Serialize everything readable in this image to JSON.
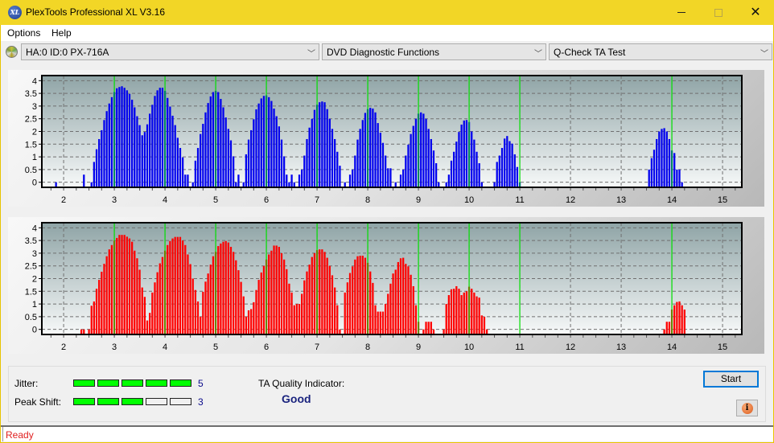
{
  "window": {
    "title": "PlexTools Professional XL V3.16",
    "app_icon": "xl-logo-icon",
    "controls": {
      "minimize": "minimize-icon",
      "maximize": "maximize-icon",
      "close": "close-icon"
    }
  },
  "menu": {
    "items": [
      {
        "label": "Options"
      },
      {
        "label": "Help"
      }
    ]
  },
  "toolbar": {
    "drive_icon": "disc-icon",
    "drive_select": {
      "value": "HA:0 ID:0  PX-716A"
    },
    "function_select": {
      "value": "DVD Diagnostic Functions"
    },
    "test_select": {
      "value": "Q-Check TA Test"
    },
    "dropdown_icon": "chevron-down-icon"
  },
  "colors": {
    "top_bars": "#0000ee",
    "bottom_bars": "#ff0000",
    "marker_lines": "#00e000",
    "meter_on": "#00ff00",
    "quality_text": "#1a237e",
    "status_text": "#e02020"
  },
  "chart_data": [
    {
      "type": "bar",
      "title": "",
      "series_name": "TA histogram (lands)",
      "color": "#0000ee",
      "xlabel": "",
      "ylabel": "",
      "xlim": [
        1.57,
        15.38
      ],
      "ylim": [
        -0.2,
        4.2
      ],
      "x_ticks": [
        "2",
        "3",
        "4",
        "5",
        "6",
        "7",
        "8",
        "9",
        "10",
        "11",
        "12",
        "13",
        "14",
        "15"
      ],
      "y_ticks": [
        "0",
        "0.5",
        "1",
        "1.5",
        "2",
        "2.5",
        "3",
        "3.5",
        "4"
      ],
      "grid": true,
      "marker_lines_x": [
        3,
        4,
        5,
        6,
        7,
        8,
        9,
        10,
        11,
        14
      ],
      "x_start": 1.85,
      "x_step": 0.05,
      "values": [
        0.0,
        -1,
        -1,
        -1,
        -1,
        -1,
        -1,
        -1,
        -1,
        -1,
        -1,
        0.3,
        -1,
        -1,
        0.0,
        0.8,
        1.3,
        1.7,
        2.05,
        2.45,
        2.8,
        3.1,
        3.35,
        3.55,
        3.7,
        3.75,
        3.78,
        3.72,
        3.62,
        3.48,
        3.25,
        2.95,
        2.6,
        2.25,
        1.85,
        1.98,
        2.28,
        2.7,
        3.05,
        3.4,
        3.62,
        3.72,
        3.72,
        3.6,
        3.32,
        2.98,
        2.62,
        2.25,
        1.75,
        1.35,
        0.98,
        0.3,
        0.3,
        -1,
        0.0,
        0.85,
        1.35,
        1.9,
        2.3,
        2.75,
        3.12,
        3.38,
        3.55,
        3.6,
        3.55,
        3.28,
        2.95,
        2.55,
        2.1,
        1.65,
        1.02,
        0.0,
        0.3,
        -1,
        0.0,
        1.1,
        1.68,
        2.05,
        2.48,
        2.87,
        3.1,
        3.3,
        3.4,
        3.42,
        3.35,
        3.2,
        2.9,
        2.6,
        2.2,
        1.68,
        1.02,
        0.3,
        0.0,
        0.3,
        0.0,
        -1,
        0.3,
        0.5,
        1.05,
        1.7,
        2.15,
        2.5,
        2.85,
        3.05,
        3.15,
        3.18,
        3.15,
        2.88,
        2.5,
        2.1,
        1.7,
        1.2,
        0.65,
        -1,
        0.0,
        -1,
        0.3,
        0.5,
        1.05,
        1.68,
        2.1,
        2.45,
        2.73,
        2.88,
        2.93,
        2.9,
        2.75,
        2.33,
        1.95,
        1.55,
        1.05,
        0.55,
        0.55,
        -1,
        0.0,
        -1,
        0.3,
        0.5,
        1.05,
        1.48,
        1.9,
        2.22,
        2.5,
        2.7,
        2.75,
        2.7,
        2.5,
        2.1,
        1.7,
        1.25,
        0.75,
        0.0,
        -1,
        -1,
        0.0,
        0.3,
        0.85,
        1.2,
        1.6,
        1.98,
        2.27,
        2.43,
        2.45,
        2.37,
        2.0,
        1.68,
        1.2,
        0.75,
        0.0,
        -1,
        -1,
        -1,
        -1,
        0.0,
        0.8,
        1.05,
        1.35,
        1.72,
        1.82,
        1.62,
        1.52,
        1.1,
        0.6,
        0.0
      ],
      "values_note": "-1 means no bar at that bin; tail near 14",
      "tail_x_start": 13.55,
      "tail_values": [
        0.5,
        0.95,
        1.28,
        1.7,
        2.0,
        2.1,
        2.13,
        2.0,
        1.7,
        1.25,
        1.15,
        0.5,
        0.5,
        0.0
      ]
    },
    {
      "type": "bar",
      "title": "",
      "series_name": "TA histogram (pits)",
      "color": "#ff0000",
      "xlabel": "",
      "ylabel": "",
      "xlim": [
        1.57,
        15.38
      ],
      "ylim": [
        -0.2,
        4.2
      ],
      "x_ticks": [
        "2",
        "3",
        "4",
        "5",
        "6",
        "7",
        "8",
        "9",
        "10",
        "11",
        "12",
        "13",
        "14",
        "15"
      ],
      "y_ticks": [
        "0",
        "0.5",
        "1",
        "1.5",
        "2",
        "2.5",
        "3",
        "3.5",
        "4"
      ],
      "grid": true,
      "marker_lines_x": [
        3,
        4,
        5,
        6,
        7,
        8,
        9,
        10,
        11,
        14
      ],
      "x_start": 2.35,
      "x_step": 0.05,
      "values": [
        0.0,
        0.0,
        -1,
        0.0,
        0.93,
        1.1,
        1.6,
        1.95,
        2.27,
        2.58,
        2.88,
        3.15,
        3.32,
        3.5,
        3.6,
        3.72,
        3.72,
        3.72,
        3.65,
        3.58,
        3.45,
        3.1,
        2.8,
        2.35,
        1.65,
        1.28,
        0.35,
        0.65,
        1.45,
        1.85,
        2.25,
        2.6,
        2.85,
        3.1,
        3.32,
        3.48,
        3.58,
        3.64,
        3.64,
        3.64,
        3.5,
        3.32,
        2.95,
        2.57,
        2.0,
        1.55,
        1.1,
        0.5,
        1.48,
        1.88,
        2.2,
        2.55,
        2.88,
        3.05,
        3.28,
        3.38,
        3.45,
        3.48,
        3.42,
        3.25,
        3.05,
        2.72,
        2.33,
        1.87,
        1.3,
        0.5,
        0.75,
        0.8,
        1.07,
        1.55,
        1.95,
        2.24,
        2.5,
        2.75,
        2.95,
        3.1,
        3.3,
        3.3,
        3.25,
        3.0,
        2.75,
        2.37,
        1.8,
        1.45,
        0.95,
        1.0,
        1.0,
        1.4,
        1.93,
        2.28,
        2.55,
        2.85,
        3.0,
        3.12,
        3.15,
        3.15,
        3.05,
        2.82,
        2.5,
        2.13,
        1.65,
        0.95,
        0.0,
        -1,
        1.45,
        1.85,
        2.22,
        2.48,
        2.75,
        2.88,
        2.9,
        2.9,
        2.82,
        2.62,
        2.28,
        1.83,
        0.95,
        0.7,
        0.7,
        0.7,
        1.0,
        1.4,
        1.8,
        2.2,
        2.35,
        2.65,
        2.8,
        2.82,
        2.58,
        2.48,
        2.15,
        1.7,
        0.95,
        0.3,
        -1,
        0.0,
        0.3,
        0.3,
        0.3,
        0.0,
        -1,
        -1,
        -1,
        0.0,
        1.0,
        1.35,
        1.58,
        1.6,
        1.7,
        1.6,
        1.35,
        1.45,
        1.5,
        1.68,
        1.6,
        1.45,
        1.3,
        1.25,
        0.55,
        0.5,
        0.0
      ],
      "tail_x_start": 13.85,
      "tail_values": [
        0.0,
        0.3,
        0.3,
        0.78,
        0.95,
        1.08,
        1.1,
        0.95,
        0.78
      ]
    }
  ],
  "metrics": {
    "jitter": {
      "label": "Jitter:",
      "value": 5,
      "max": 5
    },
    "peak_shift": {
      "label": "Peak Shift:",
      "value": 3,
      "max": 5
    },
    "quality": {
      "label": "TA Quality Indicator:",
      "value": "Good"
    }
  },
  "buttons": {
    "start": "Start",
    "info_icon": "info-icon"
  },
  "status": {
    "text": "Ready"
  }
}
